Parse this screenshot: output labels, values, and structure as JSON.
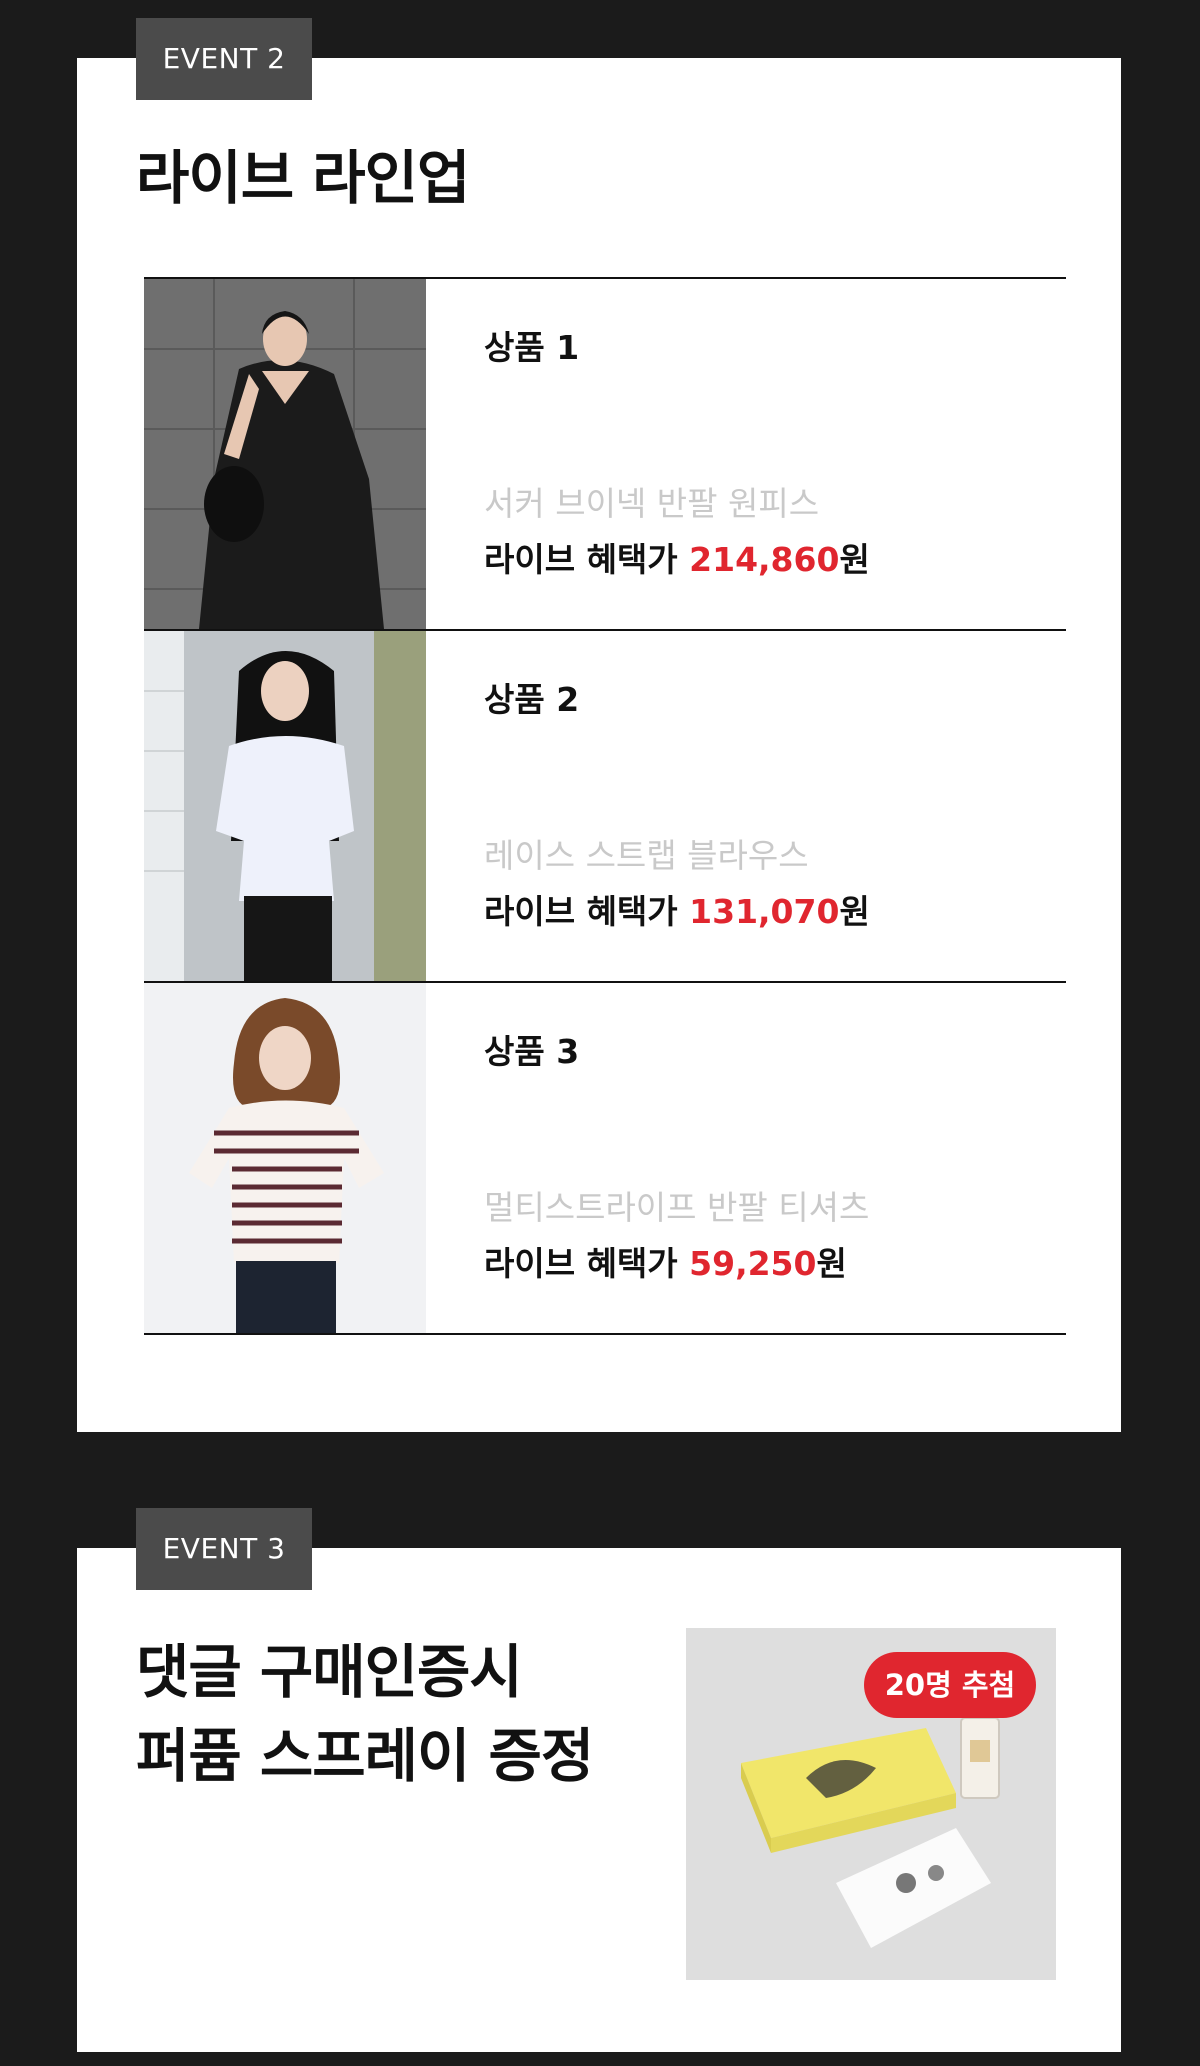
{
  "event2": {
    "tag": "EVENT 2",
    "title": "라이브 라인업",
    "products": [
      {
        "index_label": "상품 1",
        "name": "서커 브이넥 반팔 원피스",
        "price_prefix": "라이브 혜택가 ",
        "price_value": "214,860",
        "price_suffix": "원",
        "image": "woman-black-dress-photo"
      },
      {
        "index_label": "상품 2",
        "name": "레이스 스트랩 블라우스",
        "price_prefix": "라이브 혜택가 ",
        "price_value": "131,070",
        "price_suffix": "원",
        "image": "woman-white-blouse-photo"
      },
      {
        "index_label": "상품 3",
        "name": "멀티스트라이프 반팔 티셔츠",
        "price_prefix": "라이브 혜택가 ",
        "price_value": "59,250",
        "price_suffix": "원",
        "image": "woman-striped-tshirt-photo"
      }
    ]
  },
  "event3": {
    "tag": "EVENT 3",
    "title_line1": "댓글 구매인증시",
    "title_line2": "퍼퓸 스프레이 증정",
    "badge": "20명 추첨",
    "image": "perfume-gift-set-photo"
  },
  "colors": {
    "background": "#1b1b1b",
    "panel": "#ffffff",
    "tag": "#4b4b4b",
    "accent": "#e0262f",
    "muted_text": "#c9c9c9"
  }
}
